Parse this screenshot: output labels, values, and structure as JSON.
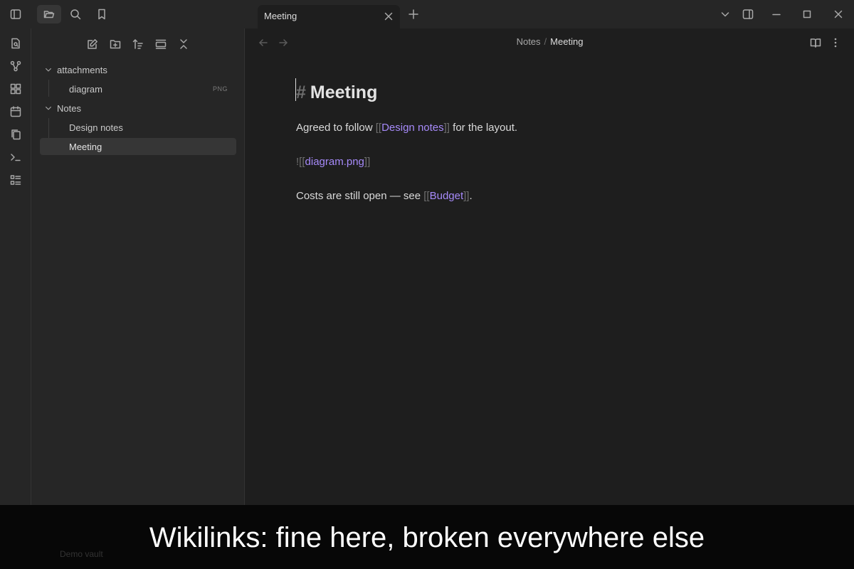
{
  "tab": {
    "title": "Meeting"
  },
  "sidebar": {
    "tree": [
      {
        "label": "attachments",
        "type": "folder",
        "expanded": true
      },
      {
        "label": "diagram",
        "type": "file",
        "ext": "PNG"
      },
      {
        "label": "Notes",
        "type": "folder",
        "expanded": true
      },
      {
        "label": "Design notes",
        "type": "file"
      },
      {
        "label": "Meeting",
        "type": "file",
        "active": true
      }
    ],
    "vault_name": "Demo vault"
  },
  "editor": {
    "breadcrumb": {
      "folder": "Notes",
      "separator": "/",
      "current": "Meeting"
    },
    "heading": {
      "marker": "#",
      "text": "Meeting"
    },
    "line1": {
      "before": "Agreed to follow ",
      "open": "[[",
      "link": "Design notes",
      "close": "]]",
      "after": " for the layout."
    },
    "line2": {
      "open": "![[",
      "link": "diagram.png",
      "close": "]]"
    },
    "line3": {
      "before": "Costs are still open — see ",
      "open": "[[",
      "link": "Budget",
      "close": "]]",
      "after": "."
    }
  },
  "caption": "Wikilinks: fine here, broken everywhere else",
  "colors": {
    "link": "#a68af9",
    "background": "#1e1e1e",
    "panel": "#262626",
    "active_row": "#363636"
  }
}
